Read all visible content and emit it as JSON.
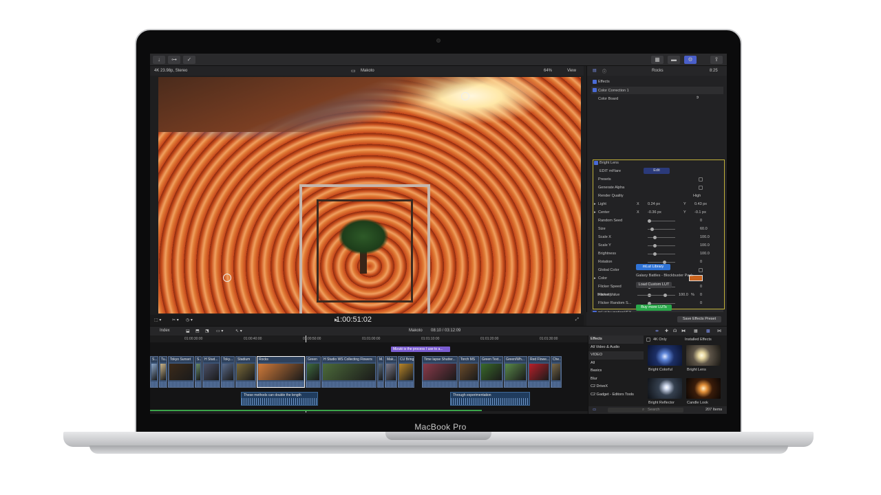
{
  "device": {
    "brand": "MacBook Pro"
  },
  "toolbar": {
    "share_icon": "share-icon"
  },
  "viewer": {
    "format": "4K 23.98p, Stereo",
    "project": "Makoto",
    "zoom": "64%",
    "view_label": "View",
    "timecode": "1:00:51:02"
  },
  "inspector": {
    "clip_name": "Rocks",
    "clip_time": "8:25",
    "effects_label": "Effects",
    "color_correction": "Color Correction 1",
    "color_board": "Color Board",
    "bright_lens": "Bright Lens",
    "edit_mflare": "EDIT mFlare",
    "edit_btn": "Edit",
    "rows": [
      {
        "label": "Presets",
        "type": "check"
      },
      {
        "label": "Generate Alpha",
        "type": "check"
      },
      {
        "label": "Render Quality",
        "value": "High"
      },
      {
        "label": "Light",
        "x": "0.24 px",
        "y": "0.43 px"
      },
      {
        "label": "Center",
        "x": "-0.36 px",
        "y": "-0.1 px"
      },
      {
        "label": "Random Seed",
        "value": "0"
      },
      {
        "label": "Size",
        "value": "60.0"
      },
      {
        "label": "Scale X",
        "value": "100.0"
      },
      {
        "label": "Scale Y",
        "value": "100.0"
      },
      {
        "label": "Brightness",
        "value": "100.0"
      },
      {
        "label": "Rotation",
        "value": "0"
      },
      {
        "label": "Global Color",
        "type": "check"
      },
      {
        "label": "Color",
        "type": "swatch"
      },
      {
        "label": "Flicker Speed",
        "value": "0"
      },
      {
        "label": "Flicker Value",
        "value": "0"
      },
      {
        "label": "Flicker Random S...",
        "value": "0"
      }
    ],
    "mlut": "mLut by motionVFX",
    "mlut_library": "mLut Library",
    "galaxy": "Galaxy Battles - Blockbuster Pack",
    "load_lut": "Load Custom LUT",
    "intensity_label": "Intensity",
    "intensity_value": "100.0",
    "intensity_unit": "%",
    "buy_luts": "Buy more LUTs",
    "save_preset": "Save Effects Preset",
    "axis_x": "X",
    "axis_y": "Y",
    "px": "px"
  },
  "timeline": {
    "index_label": "Index",
    "project": "Makoto",
    "position": "08:10 / 03:12:09",
    "ruler": [
      "01:00:30:00",
      "01:00:40:00",
      "01:00:50:00",
      "01:01:00:00",
      "01:01:10:00",
      "01:01:20:00",
      "01:01:30:00"
    ],
    "title_clip_1": "Mizuki is the process I use to a...",
    "clips": [
      "S...",
      "Tu...",
      "Tokyo Sunset",
      "S...",
      "H Stud...",
      "Toky...",
      "Stadium",
      "Rocks",
      "Green",
      "H Studio WS Collecting Flowers",
      "M...",
      "Mak...",
      "CU Bring",
      "Time lapse Shutter...",
      "Torch MS",
      "Green Text...",
      "Green/Wh...",
      "Red Flowe...",
      "Che..."
    ],
    "audio_1": "These methods can double the length",
    "audio_2": "Through experimentation"
  },
  "effects_browser": {
    "header": "Effects",
    "four_k_only": "4K Only",
    "installed": "Installed Effects",
    "categories": [
      "All Video & Audio",
      "VIDEO",
      "All",
      "Basics",
      "Blur",
      "C2 DriveX",
      "C2 Gadget - Editors Tools"
    ],
    "items": [
      "Bright Colorful",
      "Bright Lens",
      "Bright Reflector",
      "Candle Look"
    ],
    "search_placeholder": "Search",
    "count": "207 Items"
  }
}
